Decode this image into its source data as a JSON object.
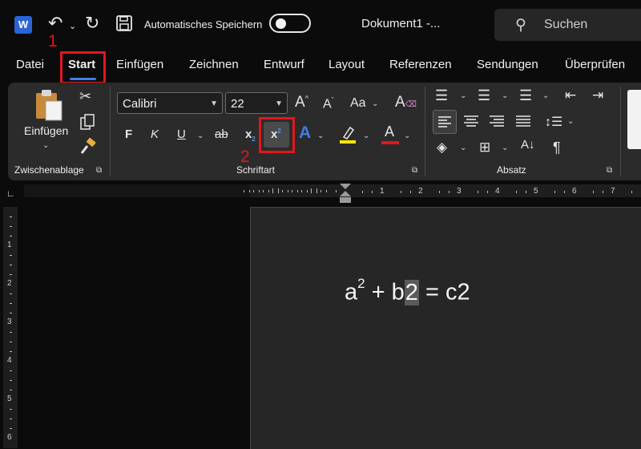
{
  "titlebar": {
    "app_logo": "W",
    "autosave_label": "Automatisches Speichern",
    "document_title": "Dokument1  -...",
    "search_placeholder": "Suchen"
  },
  "menu": {
    "tabs": [
      "Datei",
      "Start",
      "Einfügen",
      "Zeichnen",
      "Entwurf",
      "Layout",
      "Referenzen",
      "Sendungen",
      "Überprüfen"
    ],
    "active": "Start"
  },
  "ribbon": {
    "clipboard": {
      "paste_label": "Einfügen",
      "group_label": "Zwischenablage"
    },
    "font": {
      "font_name": "Calibri",
      "font_size": "22",
      "bold": "F",
      "italic": "K",
      "underline": "U",
      "strikethrough": "ab",
      "subscript": "x",
      "superscript": "x",
      "grow_font": "A",
      "shrink_font": "A",
      "change_case": "Aa",
      "text_effects": "A",
      "font_color": "A",
      "group_label": "Schriftart"
    },
    "paragraph": {
      "group_label": "Absatz"
    }
  },
  "annotations": {
    "step1": "1",
    "step2": "2"
  },
  "ruler": {
    "numbers": [
      "1",
      "2",
      "3",
      "4",
      "5",
      "6",
      "7"
    ]
  },
  "document": {
    "a": "a",
    "exp": "2",
    "plus": " + b",
    "selected": "2",
    "rest": " = c2"
  },
  "colors": {
    "highlight_red": "#e3161d",
    "accent_blue": "#3f7ee8",
    "highlighter_yellow": "#ffe600",
    "font_color_red": "#e3161d"
  }
}
